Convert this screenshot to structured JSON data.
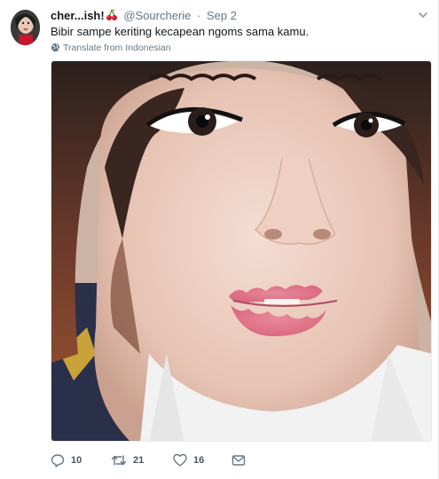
{
  "tweet": {
    "name": "cher...ish!",
    "handle": "@Sourcherie",
    "separator": "·",
    "time": "Sep 2",
    "text": "Bibir sampe keriting kecapean ngoms sama kamu.",
    "translate": "Translate from Indonesian",
    "avatar": "user-avatar",
    "media": "selfie-photo"
  },
  "actions": {
    "reply_count": "10",
    "retweet_count": "21",
    "like_count": "16"
  },
  "icons": {
    "caret": "chevron-down-icon",
    "globe": "globe-icon",
    "reply": "reply-icon",
    "retweet": "retweet-icon",
    "like": "heart-icon",
    "message": "envelope-icon",
    "emoji": "cherry-emoji"
  },
  "colors": {
    "text": "#14171a",
    "secondary": "#657786",
    "border": "#e6ecf0",
    "cherry": "#d0162e"
  }
}
